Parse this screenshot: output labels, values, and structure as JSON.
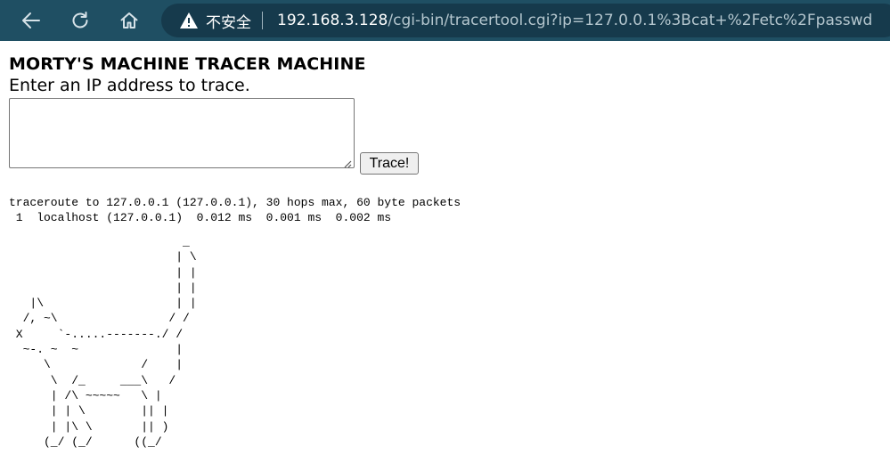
{
  "browser": {
    "back_icon": "back-arrow-icon",
    "refresh_icon": "refresh-icon",
    "home_icon": "home-icon",
    "security_icon": "warning-icon",
    "security_label": "不安全",
    "url_host": "192.168.3.128",
    "url_path": "/cgi-bin/tracertool.cgi?ip=127.0.0.1%3Bcat+%2Fetc%2Fpasswd",
    "toolbar_color": "#1f4f63",
    "address_bg_color": "#163a4c"
  },
  "page": {
    "title": "MORTY'S MACHINE TRACER MACHINE",
    "prompt": "Enter an IP address to trace.",
    "ip_input_value": "",
    "trace_button_label": "Trace!",
    "traceroute_output": "traceroute to 127.0.0.1 (127.0.0.1), 30 hops max, 60 byte packets\n 1  localhost (127.0.0.1)  0.012 ms  0.001 ms  0.002 ms",
    "cat_art": "                         _\n                        | \\\n                        | |\n                        | |\n   |\\                   | |\n  /, ~\\                / /\n X     `-.....-------./ /\n  ~-. ~  ~              |\n     \\             /    |\n      \\  /_     ___\\   /\n      | /\\ ~~~~~   \\ |\n      | | \\        || |\n      | |\\ \\       || )\n     (_/ (_/      ((_/"
  }
}
